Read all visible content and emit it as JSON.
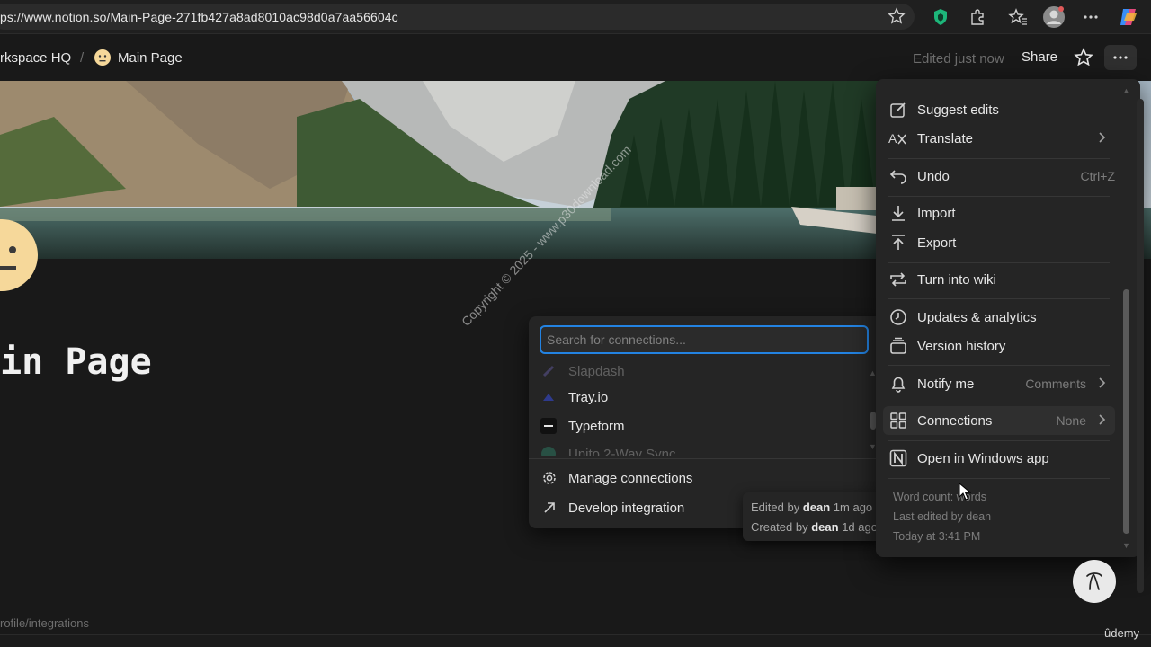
{
  "browser": {
    "url": "ps://www.notion.so/Main-Page-271fb427a8ad8010ac98d0a7aa56604c",
    "icons": [
      "star-icon",
      "shield-extension-icon",
      "extensions-icon",
      "favorites-icon",
      "profile-icon",
      "more-icon",
      "copilot-icon"
    ]
  },
  "topbar": {
    "breadcrumb_workspace": "rkspace HQ",
    "breadcrumb_sep": "/",
    "breadcrumb_page": "Main Page",
    "edited": "Edited just now",
    "share": "Share"
  },
  "page": {
    "title": "ain Page",
    "status_url": "rofile/integrations"
  },
  "connections": {
    "search_placeholder": "Search for connections...",
    "items": [
      {
        "label": "Slapdash"
      },
      {
        "label": "Tray.io"
      },
      {
        "label": "Typeform"
      },
      {
        "label": "Unito 2-Way Sync"
      }
    ],
    "manage": "Manage connections",
    "develop": "Develop integration"
  },
  "tooltip": {
    "edited_prefix": "Edited by",
    "edited_user": "dean",
    "edited_time": "1m ago",
    "created_prefix": "Created by",
    "created_user": "dean",
    "created_time": "1d ago"
  },
  "menu": {
    "suggest_edits": "Suggest edits",
    "translate": "Translate",
    "undo": "Undo",
    "undo_shortcut": "Ctrl+Z",
    "import": "Import",
    "export": "Export",
    "turn_into_wiki": "Turn into wiki",
    "updates_analytics": "Updates & analytics",
    "version_history": "Version history",
    "notify_me": "Notify me",
    "notify_value": "Comments",
    "connections": "Connections",
    "connections_value": "None",
    "open_windows": "Open in Windows app",
    "word_count": "Word count: ",
    "word_count_suffix": "words",
    "last_edited": "Last edited by dean",
    "today": "Today at 3:41 PM"
  },
  "overlay": {
    "watermark": "Copyright © 2025 - www.p30download.com",
    "udemy": "ûdemy"
  }
}
